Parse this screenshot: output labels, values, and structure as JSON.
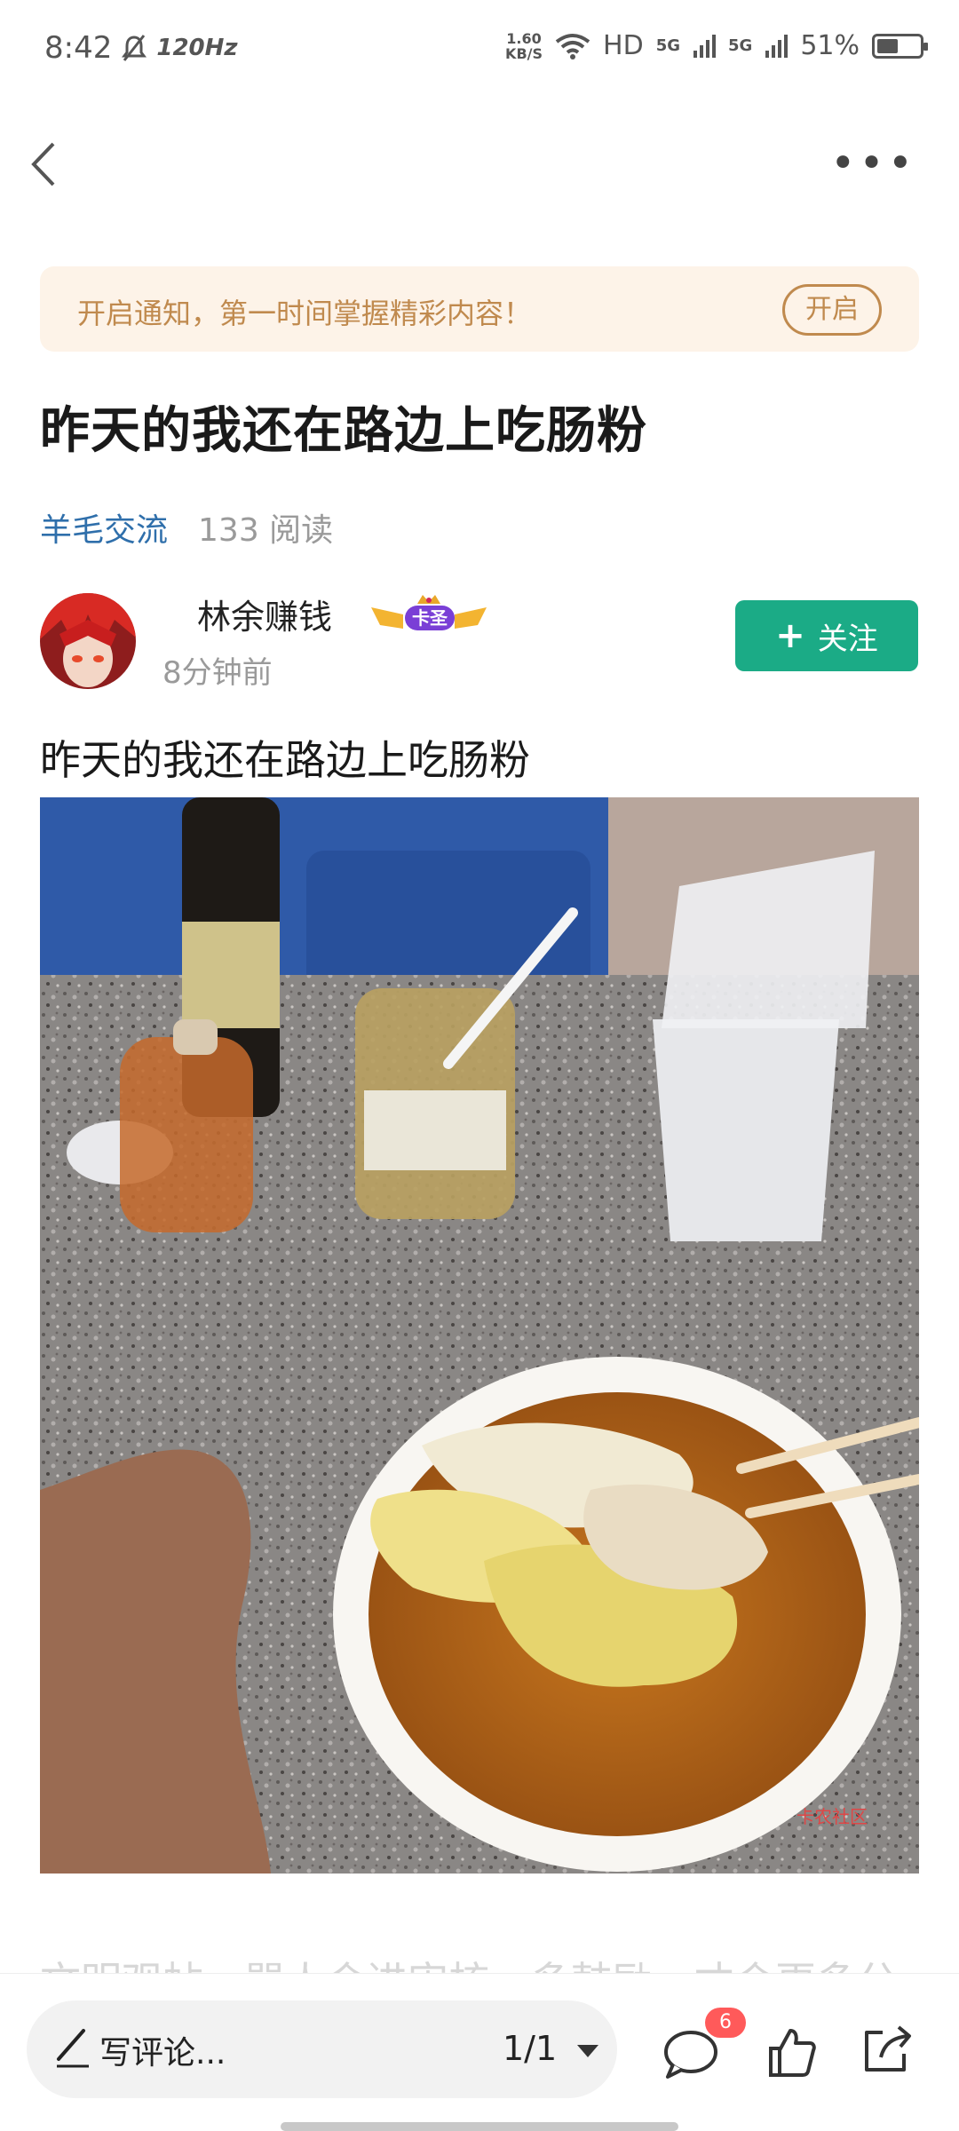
{
  "status_bar": {
    "time": "8:42",
    "refresh_rate": "120Hz",
    "net_speed_value": "1.60",
    "net_speed_unit": "KB/S",
    "network_hd": "HD",
    "signal_1": "5G",
    "signal_2": "5G",
    "battery_percent": "51%",
    "battery_level": 0.51
  },
  "nav": {
    "back_icon": "chevron-left-icon",
    "more_icon": "more-dots-icon"
  },
  "notification_banner": {
    "text": "开启通知，第一时间掌握精彩内容！",
    "button_label": "开启"
  },
  "post": {
    "title": "昨天的我还在路边上吃肠粉",
    "category": "羊毛交流",
    "reads": "133 阅读",
    "body_text": "昨天的我还在路边上吃肠粉",
    "photo_watermark": "卡农社区",
    "trailing_text": "文明观帖，骂人会进审核，多鼓励，才会更多分"
  },
  "author": {
    "name": "林余赚钱",
    "badge": "卡圣",
    "time": "8分钟前",
    "follow_label": "关注"
  },
  "bottom_bar": {
    "comment_placeholder": "写评论...",
    "page_indicator": "1/1",
    "comment_count": "6"
  },
  "colors": {
    "accent_green": "#1bab86",
    "category_blue": "#2f6fab",
    "banner_bg": "#fdf3e8",
    "banner_text": "#c08a4e",
    "badge_red": "#ff5a5a"
  }
}
